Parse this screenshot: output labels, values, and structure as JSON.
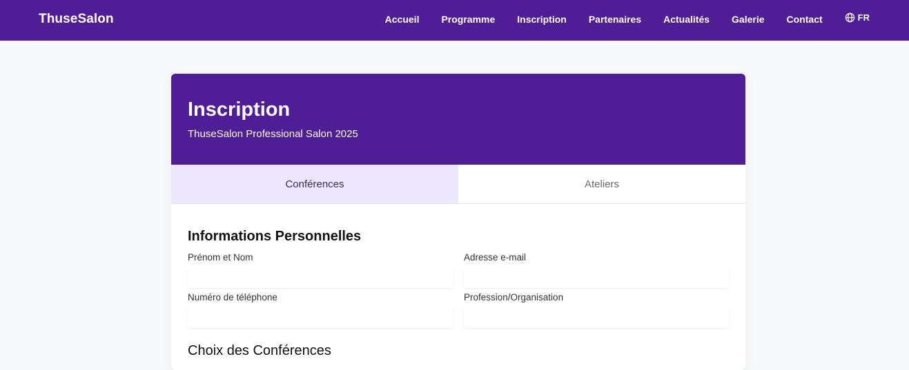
{
  "nav": {
    "brand": "ThuseSalon",
    "links": [
      "Accueil",
      "Programme",
      "Inscription",
      "Partenaires",
      "Actualités",
      "Galerie",
      "Contact"
    ],
    "lang": "FR",
    "lang_icon": "globe-icon"
  },
  "header": {
    "title": "Inscription",
    "subtitle": "ThuseSalon Professional Salon 2025"
  },
  "tabs": [
    {
      "label": "Conférences",
      "active": true
    },
    {
      "label": "Ateliers",
      "active": false
    }
  ],
  "form": {
    "section_title": "Informations Personnelles",
    "fields": {
      "name": {
        "label": "Prénom et Nom",
        "value": "",
        "placeholder": ""
      },
      "email": {
        "label": "Adresse e-mail",
        "value": "",
        "placeholder": ""
      },
      "phone": {
        "label": "Numéro de téléphone",
        "value": "",
        "placeholder": ""
      },
      "profession": {
        "label": "Profession/Organisation",
        "value": "",
        "placeholder": ""
      }
    },
    "next_section_title": "Choix des Conférences"
  },
  "colors": {
    "primary": "#4f1e96",
    "tab_active_bg": "#ede8fd",
    "page_bg": "#f7f8fa"
  }
}
